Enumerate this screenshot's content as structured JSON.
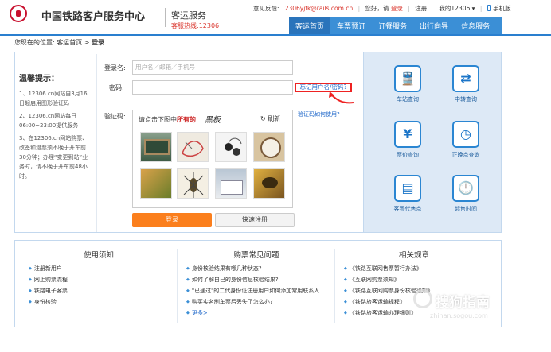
{
  "header": {
    "brand": "中国铁路客户服务中心",
    "subtitle": "客运服务",
    "hotline": "客服热线:12306",
    "feedback_label": "意见反馈:",
    "feedback_email": "12306yjfk@rails.com.cn",
    "greeting": "您好，请",
    "login_link": "登录",
    "register_link": "注册",
    "my12306": "我的12306 ▾",
    "mobile": "手机版"
  },
  "nav": {
    "items": [
      "客运首页",
      "车票预订",
      "订餐服务",
      "出行向导",
      "信息服务"
    ]
  },
  "breadcrumb": {
    "prefix": "您现在的位置:",
    "home": "客运首页",
    "sep": ">",
    "current": "登录"
  },
  "tips": {
    "title": "温馨提示：",
    "items": [
      "1、12306.cn网站自3月16日起启用图形验证码",
      "2、12306.cn网站每日06:00~23:00提供服务",
      "3、在12306.cn网站购票、改签和退票须不晚于开车前30分钟；办理“变更到站”业务时，请不晚于开车前48小时。"
    ]
  },
  "form": {
    "username_label": "登录名:",
    "username_placeholder": "用户名／邮箱／手机号",
    "password_label": "密码:",
    "forgot_password": "忘记用户名/密码?",
    "captcha_label": "验证码:",
    "captcha_instruction_prefix": "请点击下图中",
    "captcha_instruction_emph": "所有的",
    "captcha_word": "黑板",
    "refresh": "刷新",
    "captcha_help": "验证码如何使用?",
    "login_button": "登录",
    "register_button": "快速注册"
  },
  "services": [
    {
      "label": "车站查询",
      "icon": "train-station-icon"
    },
    {
      "label": "中转查询",
      "icon": "transfer-icon"
    },
    {
      "label": "票价查询",
      "icon": "fare-search-icon"
    },
    {
      "label": "正晚点查询",
      "icon": "clock-icon"
    },
    {
      "label": "客票代售点",
      "icon": "ticket-agent-icon"
    },
    {
      "label": "起售时间",
      "icon": "sale-time-icon"
    }
  ],
  "bottom": {
    "columns": [
      {
        "title": "使用须知",
        "links": [
          "注册新用户",
          "网上购票流程",
          "铁路电子客票",
          "身份核验"
        ]
      },
      {
        "title": "购票常见问题",
        "links": [
          "身份核验结果有哪几种状态?",
          "如何了解自己的身份信息核验结果?",
          "\"已通过\"的二代身份证注册用户如何添加常用联系人",
          "购买实名制车票后丢失了怎么办?"
        ],
        "more": "更多>"
      },
      {
        "title": "相关规章",
        "links": [
          "《铁路互联网售票暂行办法》",
          "《互联网购票须知》",
          "《铁路互联网购票身份核验须知》",
          "《铁路旅客运输规程》",
          "《铁路旅客运输办理细则》"
        ]
      }
    ]
  },
  "watermark": {
    "text": "搜狗指南",
    "url": "zhinan.sogou.com"
  },
  "colors": {
    "brand_red": "#c8102e",
    "nav_blue": "#3b8fd6",
    "login_orange": "#fb7f1d",
    "panel_blue": "#dde9f6",
    "link_blue": "#1c66c9",
    "highlight_red": "#e22222"
  }
}
